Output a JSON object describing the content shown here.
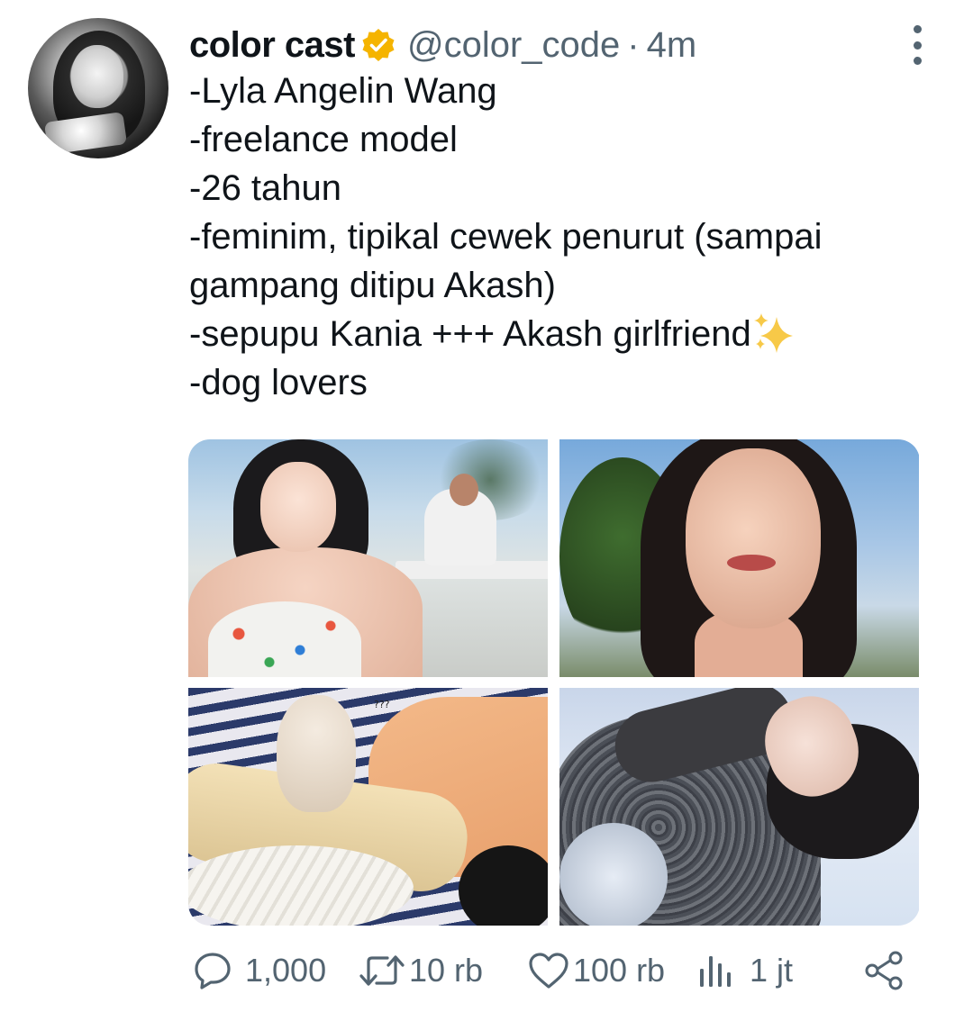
{
  "author": {
    "name": "color cast",
    "handle": "@color_code",
    "separator": "·",
    "time": "4m",
    "avatar_icon": "profile-photo",
    "verified_badge_color": "#f5b400"
  },
  "tweet": {
    "lines": [
      "-Lyla Angelin Wang",
      "-freelance model",
      "-26 tahun",
      "-feminim, tipikal cewek penurut (sampai",
      "gampang ditipu Akash)",
      "-sepupu Kania +++ Akash girlfriend",
      "-dog lovers"
    ],
    "sparkle_emoji": "sparkles-icon"
  },
  "media": {
    "photos": [
      {
        "name": "photo-1",
        "caption": ""
      },
      {
        "name": "photo-2",
        "caption": ""
      },
      {
        "name": "photo-3",
        "caption": "???"
      },
      {
        "name": "photo-4",
        "caption": ""
      }
    ]
  },
  "actions": {
    "reply_count": "1,000",
    "retweet_count": "10 rb",
    "like_count": "100 rb",
    "views_count": "1 jt"
  },
  "colors": {
    "text": "#0f1419",
    "secondary": "#536471",
    "verified": "#f5b400",
    "sparkle": "#f7c948"
  }
}
